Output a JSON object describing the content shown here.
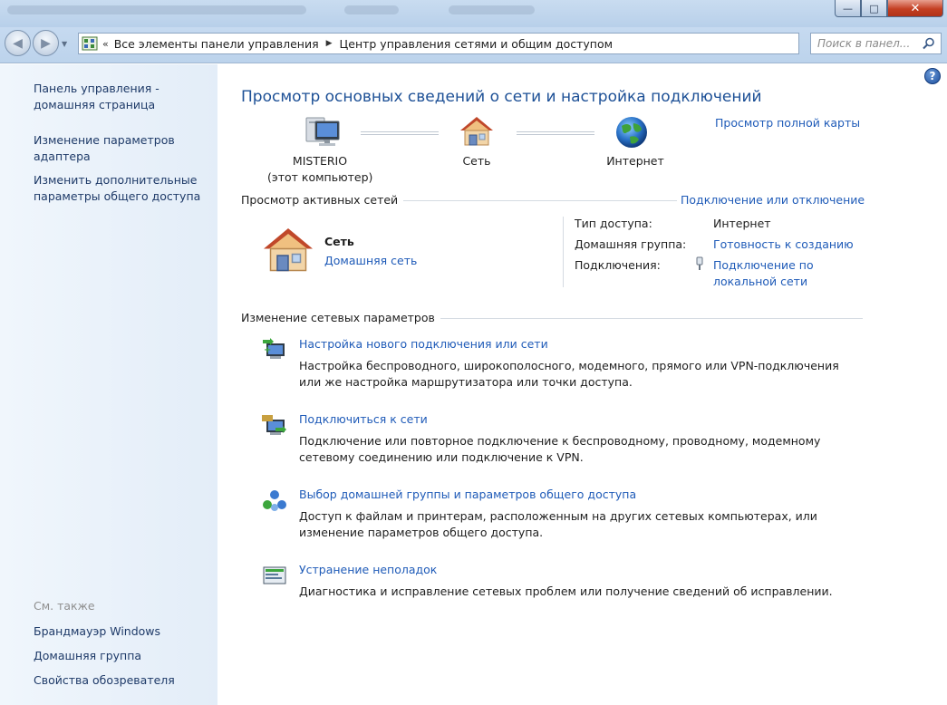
{
  "window": {
    "minimize_glyph": "—",
    "maximize_glyph": "□",
    "close_glyph": "✕"
  },
  "navbar": {
    "breadcrumb": [
      "Все элементы панели управления",
      "Центр управления сетями и общим доступом"
    ],
    "search_placeholder": "Поиск в панел..."
  },
  "sidebar": {
    "links": [
      "Панель управления - домашняя страница",
      "Изменение параметров адаптера",
      "Изменить дополнительные параметры общего доступа"
    ],
    "see_also_title": "См. также",
    "see_also": [
      "Брандмауэр Windows",
      "Домашняя группа",
      "Свойства обозревателя"
    ]
  },
  "main": {
    "title": "Просмотр основных сведений о сети и настройка подключений",
    "full_map_link": "Просмотр полной карты",
    "map": {
      "computer_name": "MISTERIO",
      "computer_note": "(этот компьютер)",
      "network": "Сеть",
      "internet": "Интернет"
    },
    "active_networks": {
      "title": "Просмотр активных сетей",
      "connect_link": "Подключение или отключение",
      "network_name": "Сеть",
      "network_type": "Домашняя сеть",
      "access_type_label": "Тип доступа:",
      "access_type_value": "Интернет",
      "homegroup_label": "Домашняя группа:",
      "homegroup_value": "Готовность к созданию",
      "connections_label": "Подключения:",
      "connections_value_1": "Подключение по",
      "connections_value_2": "локальной сети"
    },
    "change_settings": {
      "title": "Изменение сетевых параметров",
      "tasks": [
        {
          "title": "Настройка нового подключения или сети",
          "desc1": "Настройка беспроводного, широкополосного, модемного, прямого или VPN-подключения",
          "desc2": "или же настройка маршрутизатора или точки доступа."
        },
        {
          "title": "Подключиться к сети",
          "desc1": "Подключение или повторное подключение к беспроводному, проводному, модемному",
          "desc2": "сетевому соединению или подключение к VPN."
        },
        {
          "title": "Выбор домашней группы и параметров общего доступа",
          "desc1": "Доступ к файлам и принтерам, расположенным на других сетевых компьютерах, или",
          "desc2": "изменение параметров общего доступа."
        },
        {
          "title": "Устранение неполадок",
          "desc1": "Диагностика и исправление сетевых проблем или получение сведений об исправлении."
        }
      ]
    }
  }
}
